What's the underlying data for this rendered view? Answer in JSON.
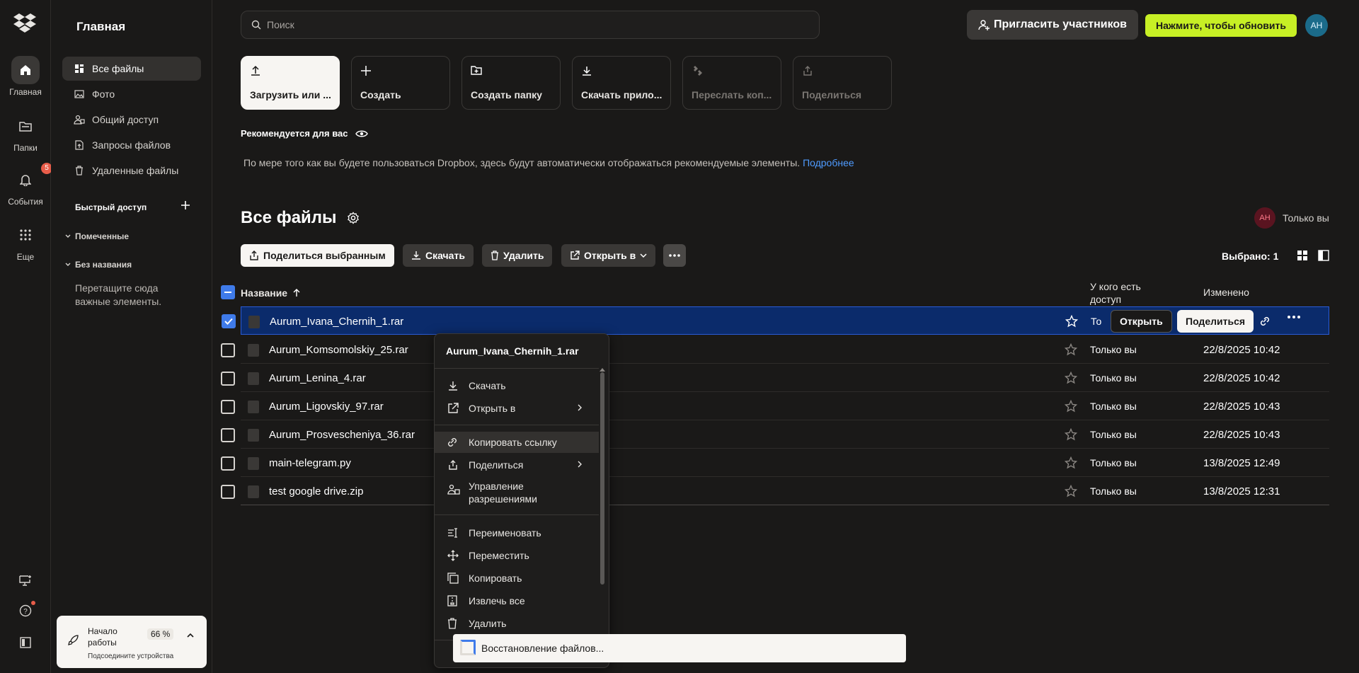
{
  "rail": {
    "items": [
      {
        "label": "Главная",
        "icon": "home-icon"
      },
      {
        "label": "Папки",
        "icon": "folders-icon"
      },
      {
        "label": "События",
        "icon": "bell-icon",
        "badge": "5"
      },
      {
        "label": "Еще",
        "icon": "grid-icon"
      }
    ]
  },
  "sidebar": {
    "title": "Главная",
    "items": [
      {
        "label": "Все файлы",
        "icon": "all-files-icon"
      },
      {
        "label": "Фото",
        "icon": "photo-icon"
      },
      {
        "label": "Общий доступ",
        "icon": "shared-icon"
      },
      {
        "label": "Запросы файлов",
        "icon": "file-request-icon"
      },
      {
        "label": "Удаленные файлы",
        "icon": "trash-icon"
      }
    ],
    "quick_access": "Быстрый доступ",
    "starred": "Помеченные",
    "untitled": "Без названия",
    "hint": "Перетащите сюда важные элементы.",
    "onboarding": {
      "title": "Начало работы",
      "percent": "66 %",
      "subtitle": "Подсоедините устройства"
    }
  },
  "header": {
    "search_placeholder": "Поиск",
    "invite": "Пригласить участников",
    "upgrade": "Нажмите, чтобы обновить",
    "avatar": "AH"
  },
  "quick_actions": [
    {
      "label": "Загрузить или ...",
      "icon": "upload-icon"
    },
    {
      "label": "Создать",
      "icon": "plus-icon"
    },
    {
      "label": "Создать папку",
      "icon": "new-folder-icon"
    },
    {
      "label": "Скачать прило...",
      "icon": "download-icon"
    },
    {
      "label": "Переслать коп...",
      "icon": "transfer-icon"
    },
    {
      "label": "Поделиться",
      "icon": "share-icon"
    }
  ],
  "recommended": {
    "title": "Рекомендуется для вас",
    "text": "По мере того как вы будете пользоваться Dropbox, здесь будут автоматически отображаться рекомендуемые элементы.",
    "link": "Подробнее"
  },
  "files_section": {
    "title": "Все файлы",
    "owner_avatar": "AH",
    "owner_label": "Только вы",
    "toolbar": {
      "share_selected": "Поделиться выбранным",
      "download": "Скачать",
      "delete": "Удалить",
      "open_in": "Открыть в"
    },
    "selected": "Выбрано: 1",
    "columns": {
      "name": "Название",
      "access": "У кого есть доступ",
      "modified": "Изменено"
    }
  },
  "files": [
    {
      "name": "Aurum_Ivana_Chernih_1.rar",
      "access": "То",
      "modified": "",
      "selected": true
    },
    {
      "name": "Aurum_Komsomolskiy_25.rar",
      "access": "Только вы",
      "modified": "22/8/2025 10:42"
    },
    {
      "name": "Aurum_Lenina_4.rar",
      "access": "Только вы",
      "modified": "22/8/2025 10:42"
    },
    {
      "name": "Aurum_Ligovskiy_97.rar",
      "access": "Только вы",
      "modified": "22/8/2025 10:43"
    },
    {
      "name": "Aurum_Prosvescheniya_36.rar",
      "access": "Только вы",
      "modified": "22/8/2025 10:43"
    },
    {
      "name": "main-telegram.py",
      "access": "Только вы",
      "modified": "13/8/2025 12:49"
    },
    {
      "name": "test google drive.zip",
      "access": "Только вы",
      "modified": "13/8/2025 12:31"
    }
  ],
  "row_actions": {
    "open": "Открыть",
    "share": "Поделиться"
  },
  "context_menu": {
    "title": "Aurum_Ivana_Chernih_1.rar",
    "items": [
      {
        "label": "Скачать",
        "icon": "download-icon"
      },
      {
        "label": "Открыть в",
        "icon": "open-external-icon"
      },
      {
        "label": "Копировать ссылку",
        "icon": "link-icon"
      },
      {
        "label": "Поделиться",
        "icon": "share-icon"
      },
      {
        "label": "Управление разрешениями",
        "icon": "permissions-icon"
      },
      {
        "label": "Переименовать",
        "icon": "rename-icon"
      },
      {
        "label": "Переместить",
        "icon": "move-icon"
      },
      {
        "label": "Копировать",
        "icon": "copy-icon"
      },
      {
        "label": "Извлечь все",
        "icon": "extract-icon"
      },
      {
        "label": "Удалить",
        "icon": "trash-icon"
      }
    ]
  },
  "toast": {
    "text": "Восстановление файлов..."
  }
}
